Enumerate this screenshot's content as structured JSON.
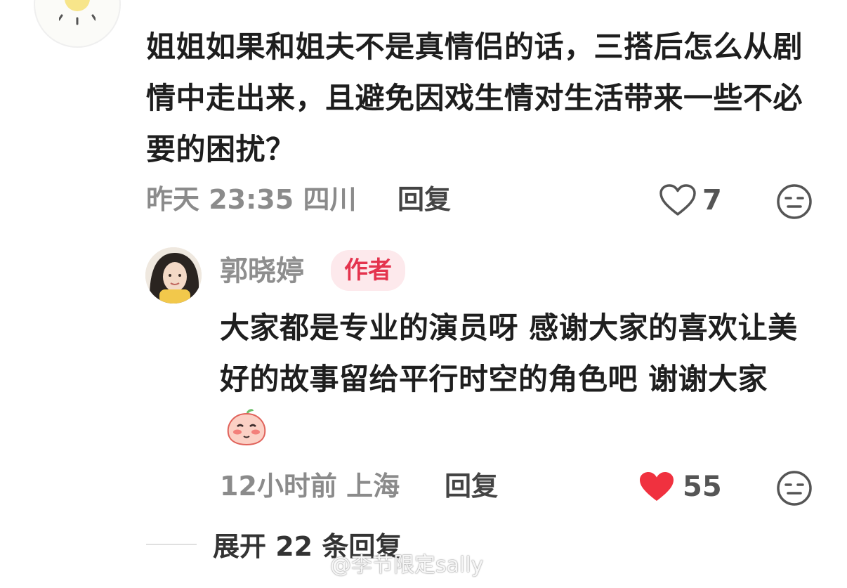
{
  "comment": {
    "text": "姐姐如果和姐夫不是真情侣的话，三搭后怎么从剧情中走出来，且避免因戏生情对生活带来一些不必要的困扰？",
    "time": "昨天 23:35",
    "location": "四川",
    "reply_label": "回复",
    "likes": "7",
    "like_icon": "heart-outline-icon",
    "dislike_icon": "meh-face-icon"
  },
  "reply": {
    "username": "郭晓婷",
    "badge": "作者",
    "text": "大家都是专业的演员呀 感谢大家的喜欢让美好的故事留给平行时空的角色吧 谢谢大家",
    "emoji": "blushing-peach-emoji",
    "time": "12小时前",
    "location": "上海",
    "reply_label": "回复",
    "likes": "55",
    "like_icon": "heart-filled-icon",
    "dislike_icon": "meh-face-icon",
    "colors": {
      "badge_bg": "#fde9ec",
      "badge_text": "#e4344e",
      "liked": "#f0313f"
    }
  },
  "expand": {
    "label": "展开 22 条回复"
  },
  "watermark": {
    "text": "@李节限定sally"
  }
}
